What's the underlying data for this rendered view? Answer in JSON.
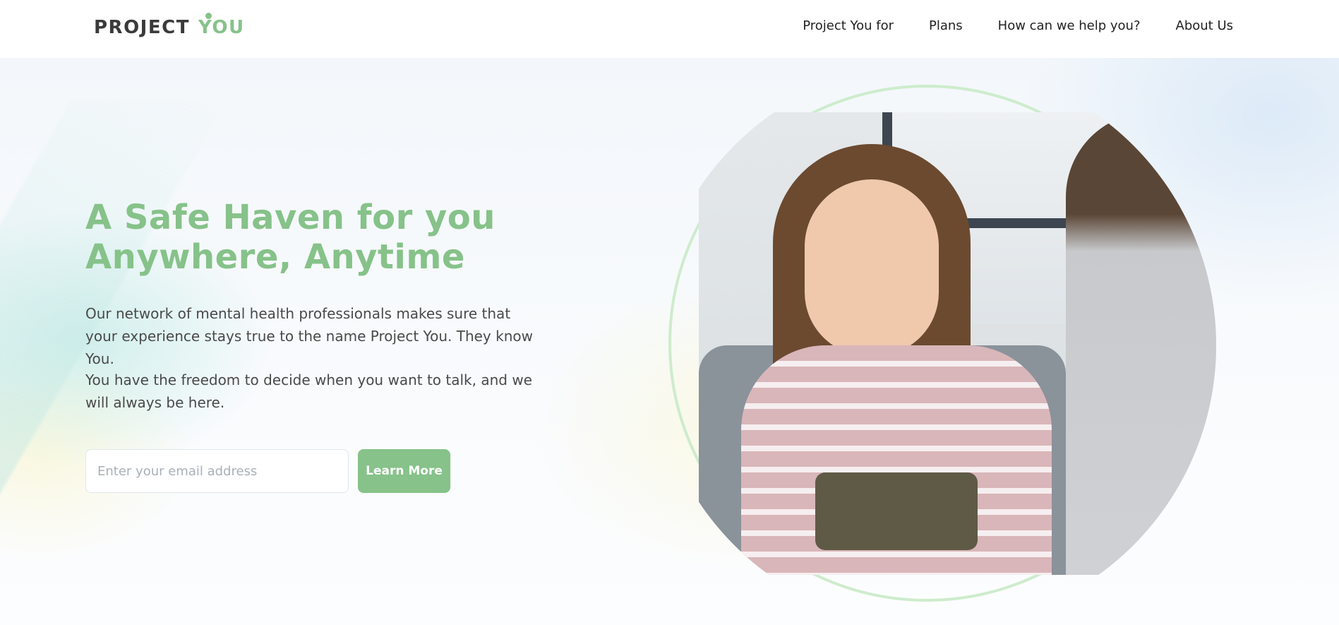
{
  "logo": {
    "part1": "PROJECT",
    "part2": "YOU"
  },
  "nav": {
    "items": [
      {
        "label": "Project You for"
      },
      {
        "label": "Plans"
      },
      {
        "label": "How can we help you?"
      },
      {
        "label": "About Us"
      }
    ]
  },
  "hero": {
    "headline_line1": "A Safe Haven for you",
    "headline_line2": "Anywhere, Anytime",
    "paragraph1": "Our network of mental health professionals makes sure that your experience stays true to the name Project You. They know You.",
    "paragraph2": "You have the freedom to decide when you want to talk, and we will always be here.",
    "email_placeholder": "Enter your email address",
    "cta_label": "Learn More"
  },
  "colors": {
    "brand_green": "#86c289",
    "logo_dark": "#3a3a3a",
    "ring": "#cdeccc"
  }
}
